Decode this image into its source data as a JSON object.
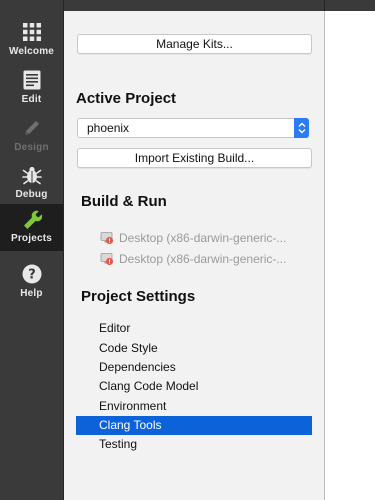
{
  "modebar": {
    "modes": [
      {
        "label": "Welcome",
        "icon": "grid-icon",
        "state": "normal"
      },
      {
        "label": "Edit",
        "icon": "document-icon",
        "state": "normal"
      },
      {
        "label": "Design",
        "icon": "pencil-icon",
        "state": "disabled"
      },
      {
        "label": "Debug",
        "icon": "bug-icon",
        "state": "normal"
      },
      {
        "label": "Projects",
        "icon": "wrench-icon",
        "state": "active"
      },
      {
        "label": "Help",
        "icon": "question-icon",
        "state": "normal"
      }
    ]
  },
  "panel": {
    "manage_kits_label": "Manage Kits...",
    "active_project_title": "Active Project",
    "active_project_value": "phoenix",
    "import_build_label": "Import Existing Build...",
    "build_run_title": "Build & Run",
    "kits": [
      {
        "label": "Desktop (x86-darwin-generic-..."
      },
      {
        "label": "Desktop (x86-darwin-generic-..."
      }
    ],
    "project_settings_title": "Project Settings",
    "settings": [
      {
        "label": "Editor"
      },
      {
        "label": "Code Style"
      },
      {
        "label": "Dependencies"
      },
      {
        "label": "Clang Code Model"
      },
      {
        "label": "Environment"
      },
      {
        "label": "Clang Tools",
        "selected": true
      },
      {
        "label": "Testing"
      }
    ]
  },
  "colors": {
    "sidebar_bg": "#3a3a3a",
    "active_mode_bg": "#1e1e1e",
    "projects_icon": "#7ec63a",
    "selection": "#0c63d9",
    "combo_arrow": "#2a7bf5"
  }
}
